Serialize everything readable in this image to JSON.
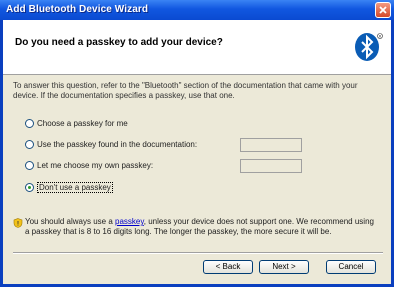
{
  "window": {
    "title": "Add Bluetooth Device Wizard"
  },
  "header": {
    "heading": "Do you need a passkey to add your device?"
  },
  "intro": "To answer this question, refer to the \"Bluetooth\" section of the documentation that came with your device. If the documentation specifies a passkey, use that one.",
  "options": [
    {
      "label": "Choose a passkey for me",
      "selected": false,
      "has_field": false
    },
    {
      "label": "Use the passkey found in the documentation:",
      "selected": false,
      "has_field": true,
      "value": ""
    },
    {
      "label": "Let me choose my own passkey:",
      "selected": false,
      "has_field": true,
      "value": ""
    },
    {
      "label": "Don't use a passkey",
      "selected": true,
      "has_field": false
    }
  ],
  "info": {
    "before_link": "You should always use a ",
    "link": "passkey",
    "after_link": ", unless your device does not support one. We recommend using a passkey that is 8 to 16 digits long. The longer the passkey, the more secure it will be."
  },
  "buttons": {
    "back": "< Back",
    "next": "Next >",
    "cancel": "Cancel"
  },
  "colors": {
    "titlebar": "#1157e0",
    "close": "#d64a2a",
    "client": "#ece9d8",
    "bluetooth": "#0a5cb5"
  },
  "icons": {
    "close": "close-icon",
    "bluetooth": "bluetooth-icon",
    "info": "warning-shield-icon"
  }
}
